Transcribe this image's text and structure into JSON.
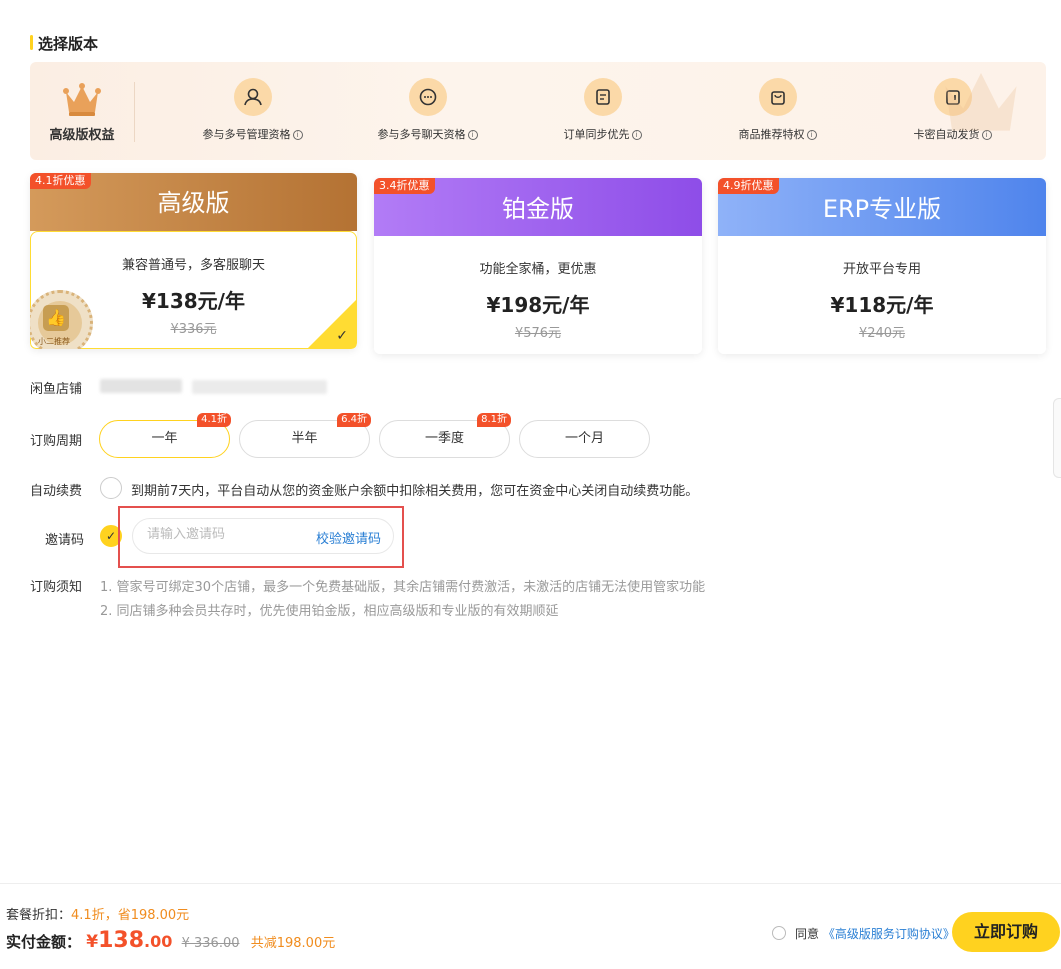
{
  "section_title": "选择版本",
  "benefits": {
    "head_label": "高级版权益",
    "items": [
      {
        "label": "参与多号管理资格",
        "icon": "users-icon"
      },
      {
        "label": "参与多号聊天资格",
        "icon": "chat-bubble-icon"
      },
      {
        "label": "订单同步优先",
        "icon": "order-note-icon"
      },
      {
        "label": "商品推荐特权",
        "icon": "shopping-bag-icon"
      },
      {
        "label": "卡密自动发货",
        "icon": "wallet-card-icon"
      }
    ]
  },
  "plans": [
    {
      "badge": "4.1折优惠",
      "name": "高级版",
      "desc": "兼容普通号，多客服聊天",
      "price": "¥138元/年",
      "orig": "¥336元",
      "seal": "小二推荐"
    },
    {
      "badge": "3.4折优惠",
      "name": "铂金版",
      "desc": "功能全家桶，更优惠",
      "price": "¥198元/年",
      "orig": "¥576元"
    },
    {
      "badge": "4.9折优惠",
      "name": "ERP专业版",
      "desc": "开放平台专用",
      "price": "¥118元/年",
      "orig": "¥240元"
    }
  ],
  "store_label": "闲鱼店铺",
  "period_label": "订购周期",
  "periods": [
    {
      "label": "一年",
      "badge": "4.1折"
    },
    {
      "label": "半年",
      "badge": "6.4折"
    },
    {
      "label": "一季度",
      "badge": "8.1折"
    },
    {
      "label": "一个月",
      "badge": ""
    }
  ],
  "auto_renew": {
    "label": "自动续费",
    "text": "到期前7天内，平台自动从您的资金账户余额中扣除相关费用，您可在资金中心关闭自动续费功能。"
  },
  "invite": {
    "label": "邀请码",
    "placeholder": "请输入邀请码",
    "verify": "校验邀请码"
  },
  "notice": {
    "label": "订购须知",
    "lines": [
      "1. 管家号可绑定30个店铺，最多一个免费基础版，其余店铺需付费激活，未激活的店铺无法使用管家功能",
      "2. 同店铺多种会员共存时，优先使用铂金版，相应高级版和专业版的有效期顺延"
    ]
  },
  "bottom": {
    "discount_label": "套餐折扣：",
    "discount_value": "4.1折，省198.00元",
    "pay_label": "实付金额：",
    "pay_symbol": "¥",
    "pay_int": "138",
    "pay_dec": ".00",
    "pay_orig": "¥ 336.00",
    "pay_save": "共减198.00元",
    "agree_prefix": "同意",
    "agree_link": "《高级版服务订购协议》",
    "buy": "立即订购"
  },
  "colors": {
    "accent": "#ffd21f",
    "price_red": "#f3512a",
    "link_blue": "#2a7fd4",
    "highlight_border": "#e4504e"
  }
}
